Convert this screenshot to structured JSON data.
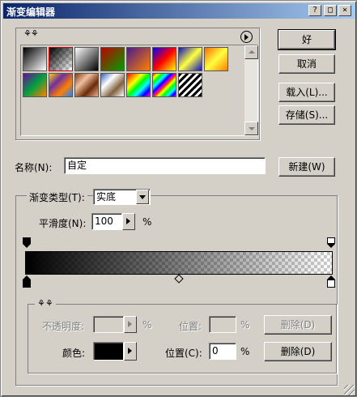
{
  "window": {
    "title": "渐变编辑器"
  },
  "title_buttons": {
    "help": "?",
    "maximize": "□",
    "close": "×"
  },
  "buttons": {
    "ok": "好",
    "cancel": "取消",
    "load": "载入(L)...",
    "save": "存储(S)...",
    "new": "新建(W)",
    "delete": "删除(D)"
  },
  "presets": {
    "menu_icon": "right-arrow-circle-icon",
    "swatches": [
      "black-white",
      "black-transparent",
      "white-black",
      "red-green",
      "violet-orange",
      "blue-red-yellow",
      "blue-yellow-blue",
      "orange-yellow-orange",
      "violet-green-orange",
      "yellow-violet-orange-blue",
      "copper",
      "chrome",
      "spectrum",
      "transparent-rainbow",
      "transparent-stripes"
    ]
  },
  "name_field": {
    "label": "名称(N):",
    "value": "自定"
  },
  "gradient_type": {
    "label": "渐变类型(T):",
    "value": "实底"
  },
  "smoothness": {
    "label": "平滑度(N):",
    "value": "100",
    "unit": "%"
  },
  "stops": {
    "opacity_label": "不透明度:",
    "opacity_unit": "%",
    "location_label_top": "位置:",
    "location_unit_top": "%",
    "color_label": "颜色:",
    "location_label_bottom": "位置(C):",
    "location_value": "0",
    "location_unit_bottom": "%"
  },
  "colors": {
    "stop_color": "#000000"
  }
}
